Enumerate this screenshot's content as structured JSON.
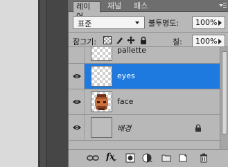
{
  "tabs": [
    {
      "label": "레이어",
      "active": true
    },
    {
      "label": "채널",
      "active": false
    },
    {
      "label": "패스",
      "active": false
    }
  ],
  "blend_mode": {
    "value": "표준"
  },
  "opacity": {
    "label": "불투명도:",
    "value": "100%"
  },
  "lock": {
    "label": "잠그기:"
  },
  "fill": {
    "label": "칠:",
    "value": "100%"
  },
  "layers": [
    {
      "name": "pallette",
      "visible": false,
      "selected": false,
      "italic": false,
      "locked": false
    },
    {
      "name": "eyes",
      "visible": true,
      "selected": true,
      "italic": false,
      "locked": false
    },
    {
      "name": "face",
      "visible": true,
      "selected": false,
      "italic": false,
      "locked": false
    },
    {
      "name": "배경",
      "visible": true,
      "selected": false,
      "italic": true,
      "locked": true
    }
  ],
  "toolbar": {
    "fx_label": "fx"
  },
  "colors": {
    "selection": "#1f7adf",
    "panel_bg": "#b8b8b8"
  }
}
